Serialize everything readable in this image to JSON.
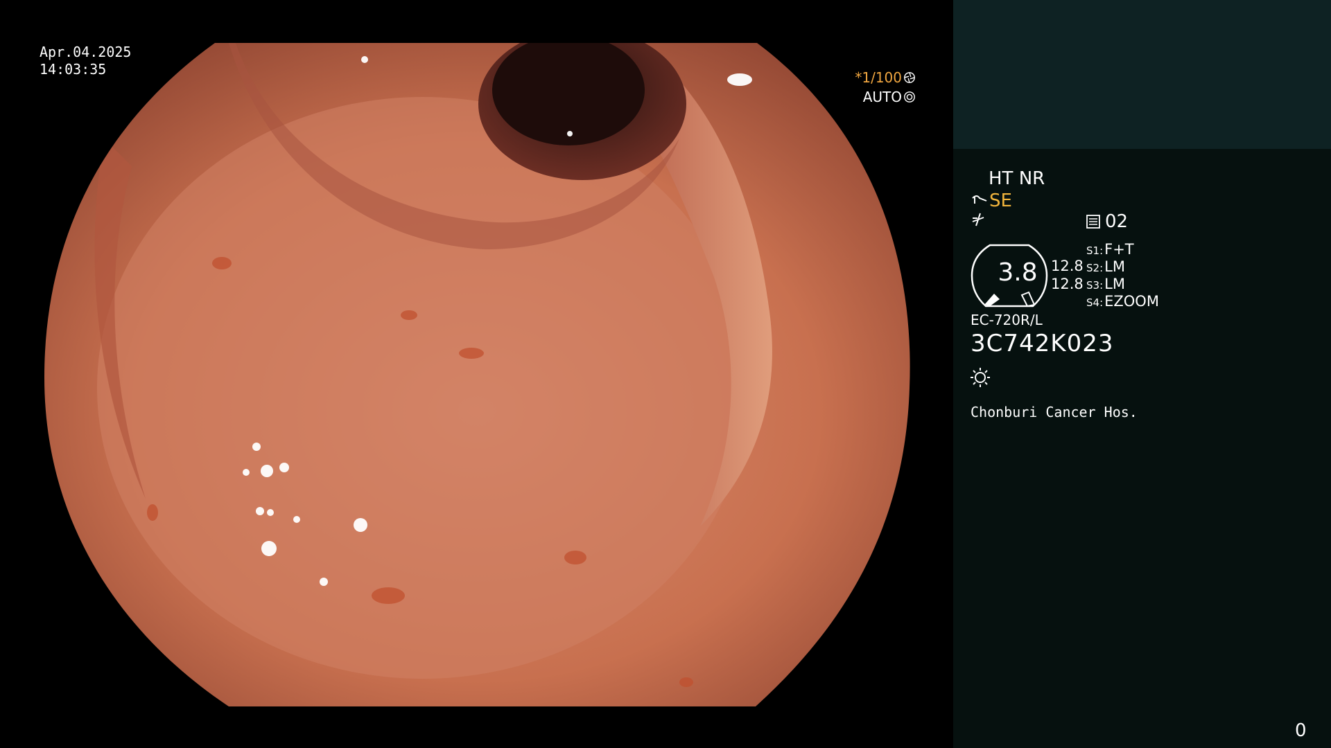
{
  "overlay": {
    "date": "Apr.04.2025",
    "time": "14:03:35",
    "shutter": "*1/100",
    "iris": "AUTO"
  },
  "status_panel": {
    "ht_nr": "HT NR",
    "se": "SE",
    "memory_label": "02",
    "gauge_value": "3.8",
    "gauge_values": [
      "12.8",
      "12.8"
    ],
    "switches": [
      {
        "key": "S1:",
        "value": "F+T"
      },
      {
        "key": "S2:",
        "value": "LM"
      },
      {
        "key": "S3:",
        "value": "LM"
      },
      {
        "key": "S4:",
        "value": "EZOOM"
      }
    ],
    "scope_model": "EC-720R/L",
    "scope_serial": "3C742K023",
    "hospital": "Chonburi Cancer Hos.",
    "corner_count": "0"
  },
  "colors": {
    "accent_orange": "#f0a640",
    "se_yellow": "#f2b53c",
    "panel_bg": "#06110f",
    "panel_top_bg": "#0e2223"
  },
  "icons": {
    "shutter": "shutter-icon",
    "iris": "iris-icon",
    "scope_curve": "scope-curve-icon",
    "memory": "memory-card-icon",
    "light": "light-sun-icon"
  }
}
